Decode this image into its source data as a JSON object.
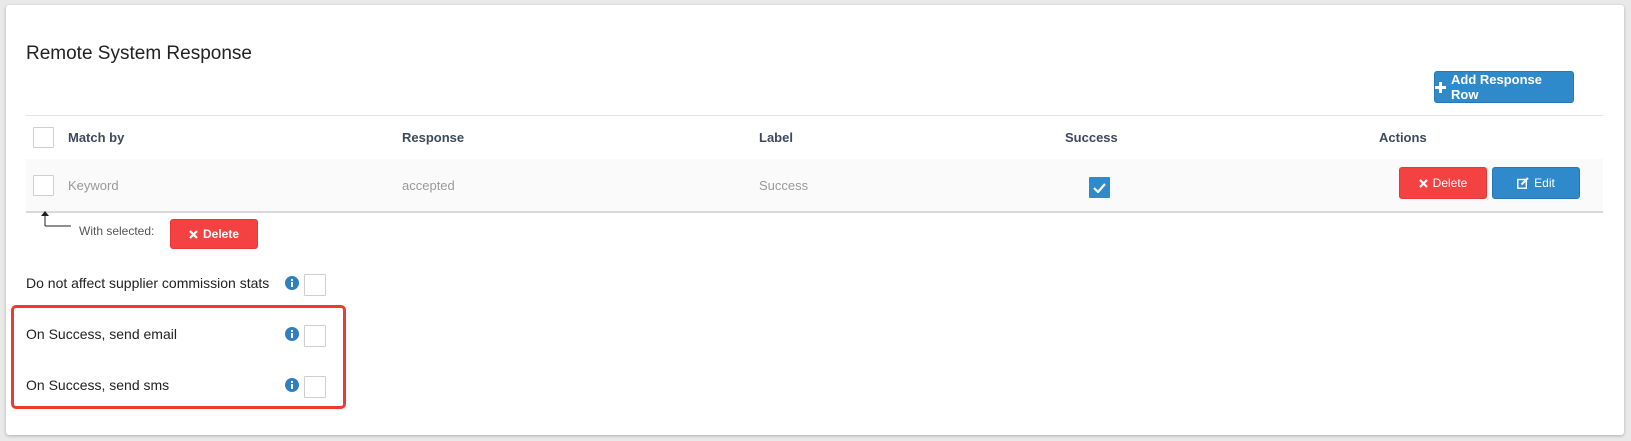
{
  "section": {
    "title": "Remote System Response"
  },
  "toolbar": {
    "add_row_label": "Add Response Row"
  },
  "table": {
    "columns": [
      "Match by",
      "Response",
      "Label",
      "Success",
      "Actions"
    ],
    "rows": [
      {
        "match_by": "Keyword",
        "response": "accepted",
        "label": "Success",
        "success": true,
        "delete_label": "Delete",
        "edit_label": "Edit"
      }
    ]
  },
  "bulk": {
    "with_selected_label": "With selected:",
    "delete_label": "Delete"
  },
  "options": [
    {
      "label": "Do not affect supplier commission stats",
      "checked": false
    },
    {
      "label": "On Success, send email",
      "checked": false
    },
    {
      "label": "On Success, send sms",
      "checked": false
    }
  ],
  "colors": {
    "primary": "#2f8acb",
    "danger": "#f44242",
    "highlight": "#f03a2e"
  }
}
